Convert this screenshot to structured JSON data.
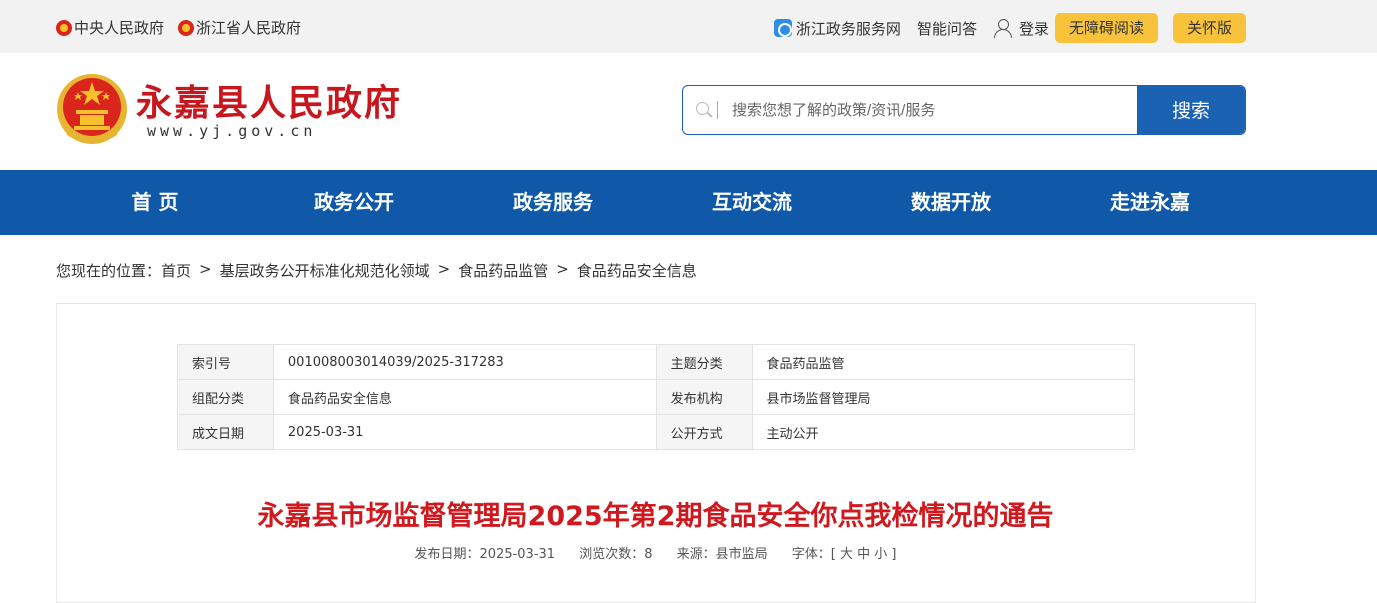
{
  "topbar": {
    "links_left": [
      "中央人民政府",
      "浙江省人民政府"
    ],
    "zwfw": "浙江政务服务网",
    "qa": "智能问答",
    "login": "登录",
    "accessible": "无障碍阅读",
    "care": "关怀版"
  },
  "header": {
    "title": "永嘉县人民政府",
    "url": "www.yj.gov.cn",
    "search_placeholder": "搜索您想了解的政策/资讯/服务",
    "search_button": "搜索"
  },
  "nav": [
    "首 页",
    "政务公开",
    "政务服务",
    "互动交流",
    "数据开放",
    "走进永嘉"
  ],
  "breadcrumb": {
    "prefix": "您现在的位置：",
    "items": [
      "首页",
      "基层政务公开标准化规范化领域",
      "食品药品监管",
      "食品药品安全信息"
    ]
  },
  "meta_table": [
    {
      "k1": "索引号",
      "v1": "001008003014039/2025-317283",
      "k2": "主题分类",
      "v2": "食品药品监管"
    },
    {
      "k1": "组配分类",
      "v1": "食品药品安全信息",
      "k2": "发布机构",
      "v2": "县市场监督管理局"
    },
    {
      "k1": "成文日期",
      "v1": "2025-03-31",
      "k2": "公开方式",
      "v2": "主动公开"
    }
  ],
  "article": {
    "title": "永嘉县市场监督管理局2025年第2期食品安全你点我检情况的通告",
    "publish_date": "发布日期：2025-03-31",
    "views": "浏览次数：8",
    "source": "来源：县市监局",
    "font_size": "字体：[ 大 中 小 ]"
  },
  "colors": {
    "brand_red": "#c8161d",
    "nav_blue": "#0f59a8",
    "pill_yellow": "#f8c33a"
  }
}
